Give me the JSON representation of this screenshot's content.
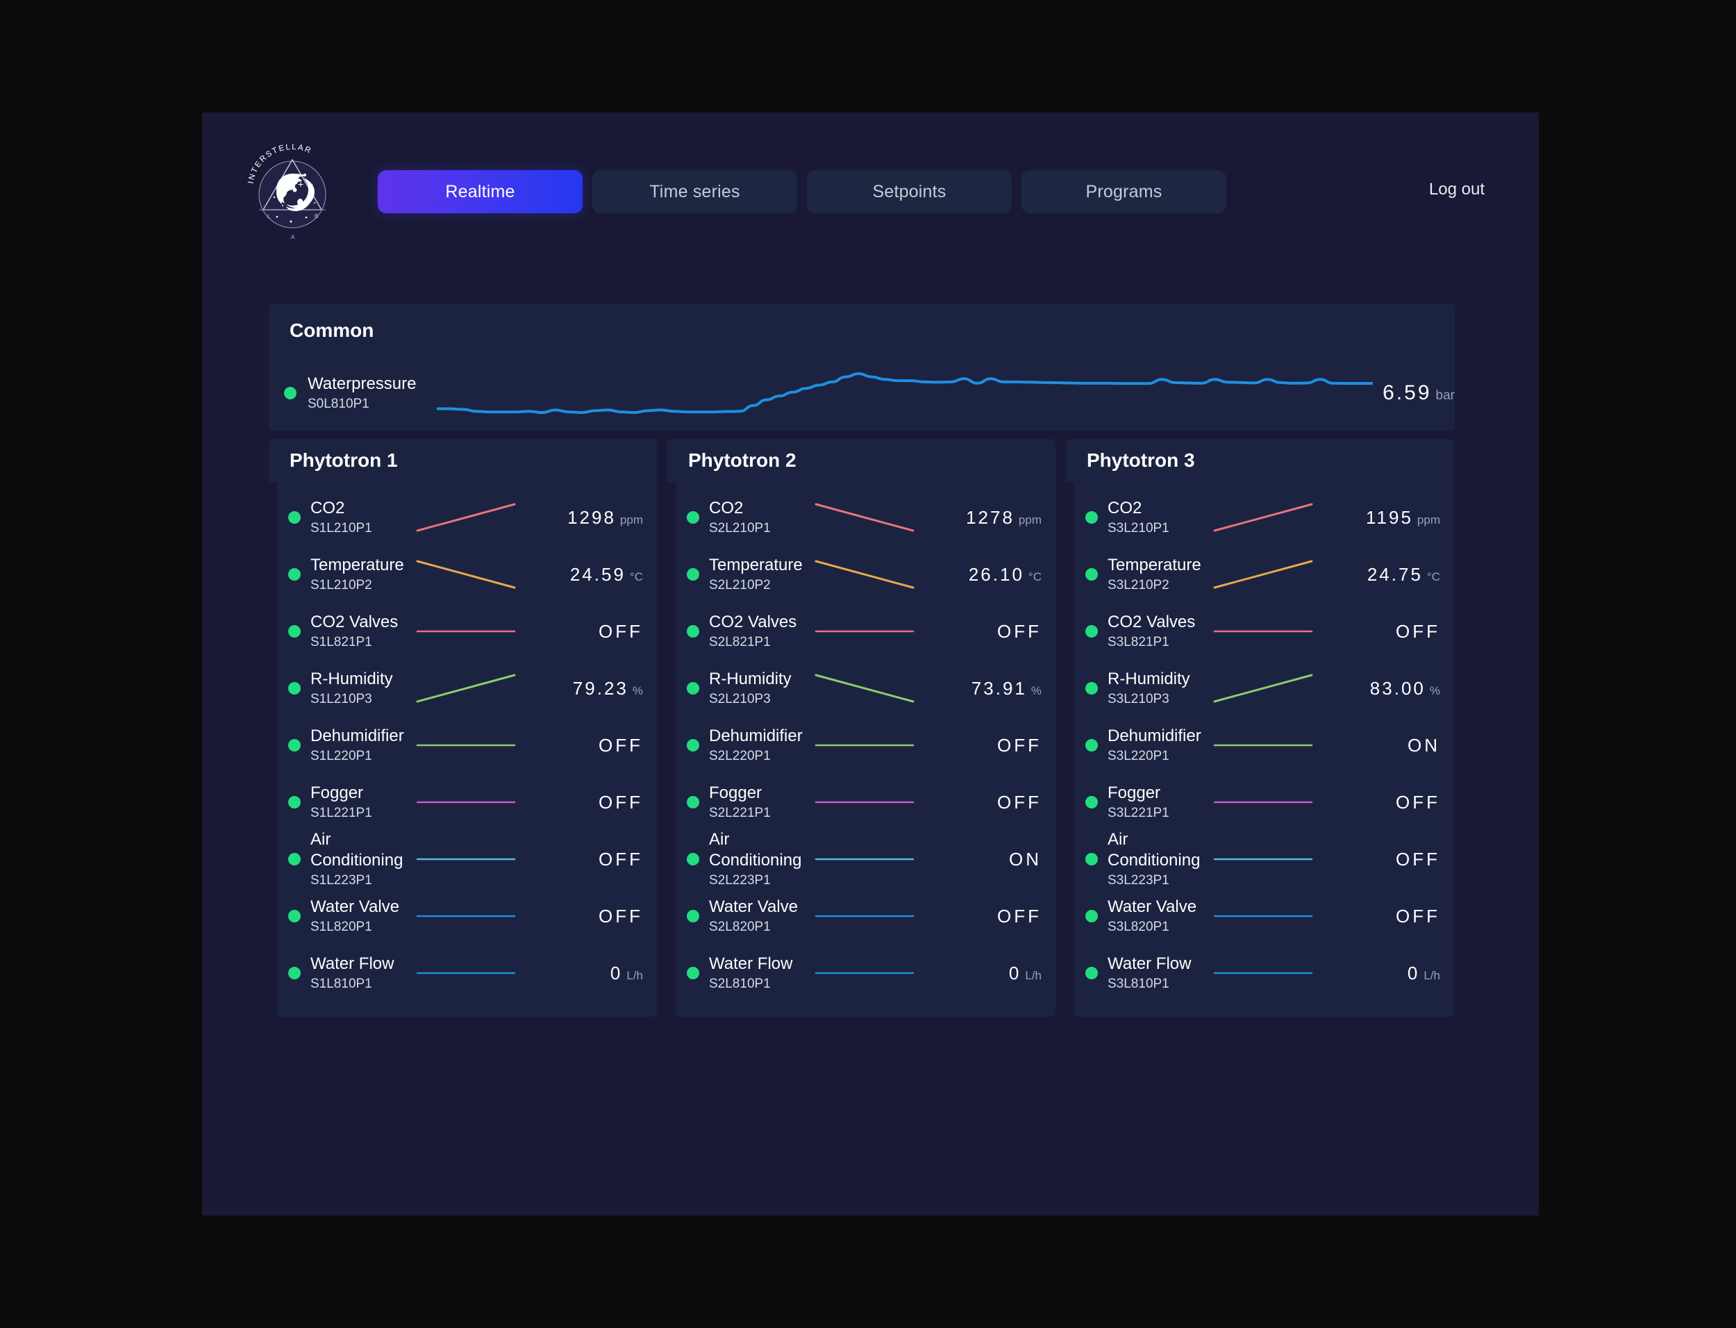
{
  "brand": {
    "name": "INTERSTELLAR",
    "ring_letters": [
      "I",
      "N",
      "T",
      "E",
      "R",
      "S",
      "T",
      "E",
      "L",
      "L",
      "A",
      "R"
    ],
    "bottom_letters": {
      "left": "L",
      "right": "B",
      "center": "A"
    }
  },
  "nav": {
    "tabs": [
      {
        "label": "Realtime",
        "active": true
      },
      {
        "label": "Time series",
        "active": false
      },
      {
        "label": "Setpoints",
        "active": false
      },
      {
        "label": "Programs",
        "active": false
      }
    ],
    "logout_label": "Log out"
  },
  "colors": {
    "accent_active": "#4a37ef",
    "status_ok": "#22dd7f",
    "co2": "#e8737f",
    "temperature": "#e8a84b",
    "humidity": "#8fcb6b",
    "fogger": "#c85bd0",
    "air": "#5fb6e0",
    "water": "#1f8fe0",
    "panel": "#1b2340",
    "frame": "#191935"
  },
  "common": {
    "title": "Common",
    "metric": {
      "name": "Waterpressure",
      "code": "S0L810P1",
      "value": "6.59",
      "unit": "bar",
      "status": "ok",
      "series_color": "#1f8fe0"
    }
  },
  "chart_data": {
    "type": "line",
    "title": "Waterpressure",
    "ylabel": "bar",
    "series": [
      {
        "name": "Waterpressure S0L810P1",
        "color": "#1f8fe0",
        "latest": 6.59,
        "unit": "bar",
        "values": [
          4.6,
          4.6,
          4.55,
          4.4,
          4.35,
          4.35,
          4.35,
          4.4,
          4.3,
          4.5,
          4.35,
          4.3,
          4.45,
          4.5,
          4.35,
          4.3,
          4.45,
          4.5,
          4.4,
          4.35,
          4.35,
          4.35,
          4.38,
          4.4,
          4.85,
          5.3,
          5.6,
          5.9,
          6.2,
          6.45,
          6.7,
          7.1,
          7.35,
          7.1,
          6.9,
          6.8,
          6.8,
          6.7,
          6.68,
          6.7,
          6.95,
          6.6,
          6.95,
          6.7,
          6.7,
          6.68,
          6.66,
          6.64,
          6.62,
          6.6,
          6.6,
          6.6,
          6.58,
          6.58,
          6.58,
          6.9,
          6.65,
          6.62,
          6.6,
          6.9,
          6.68,
          6.66,
          6.62,
          6.9,
          6.65,
          6.6,
          6.62,
          6.9,
          6.6,
          6.59,
          6.59,
          6.59
        ]
      }
    ]
  },
  "phytotrons": [
    {
      "title": "Phytotron 1",
      "metrics": [
        {
          "name": "CO2",
          "code": "S1L210P1",
          "value": "1298",
          "unit": "ppm",
          "status": "ok",
          "trend": "up",
          "color": "#e8737f",
          "kind": "numeric"
        },
        {
          "name": "Temperature",
          "code": "S1L210P2",
          "value": "24.59",
          "unit": "°C",
          "status": "ok",
          "trend": "down",
          "color": "#e8a84b",
          "kind": "numeric"
        },
        {
          "name": "CO2 Valves",
          "code": "S1L821P1",
          "value": "OFF",
          "unit": "",
          "status": "ok",
          "trend": "flat",
          "color": "#e8737f",
          "kind": "state"
        },
        {
          "name": "R-Humidity",
          "code": "S1L210P3",
          "value": "79.23",
          "unit": "%",
          "status": "ok",
          "trend": "up",
          "color": "#8fcb6b",
          "kind": "numeric"
        },
        {
          "name": "Dehumidifier",
          "code": "S1L220P1",
          "value": "OFF",
          "unit": "",
          "status": "ok",
          "trend": "flat",
          "color": "#8fcb6b",
          "kind": "state"
        },
        {
          "name": "Fogger",
          "code": "S1L221P1",
          "value": "OFF",
          "unit": "",
          "status": "ok",
          "trend": "flat",
          "color": "#c85bd0",
          "kind": "state"
        },
        {
          "name": "Air Conditioning",
          "code": "S1L223P1",
          "value": "OFF",
          "unit": "",
          "status": "ok",
          "trend": "flat",
          "color": "#5fb6e0",
          "kind": "state"
        },
        {
          "name": "Water Valve",
          "code": "S1L820P1",
          "value": "OFF",
          "unit": "",
          "status": "ok",
          "trend": "flat",
          "color": "#1f8fe0",
          "kind": "state"
        },
        {
          "name": "Water Flow",
          "code": "S1L810P1",
          "value": "0",
          "unit": "L/h",
          "status": "ok",
          "trend": "flat",
          "color": "#1f8fe0",
          "kind": "numeric"
        }
      ]
    },
    {
      "title": "Phytotron 2",
      "metrics": [
        {
          "name": "CO2",
          "code": "S2L210P1",
          "value": "1278",
          "unit": "ppm",
          "status": "ok",
          "trend": "down",
          "color": "#e8737f",
          "kind": "numeric"
        },
        {
          "name": "Temperature",
          "code": "S2L210P2",
          "value": "26.10",
          "unit": "°C",
          "status": "ok",
          "trend": "down",
          "color": "#e8a84b",
          "kind": "numeric"
        },
        {
          "name": "CO2 Valves",
          "code": "S2L821P1",
          "value": "OFF",
          "unit": "",
          "status": "ok",
          "trend": "flat",
          "color": "#e8737f",
          "kind": "state"
        },
        {
          "name": "R-Humidity",
          "code": "S2L210P3",
          "value": "73.91",
          "unit": "%",
          "status": "ok",
          "trend": "down",
          "color": "#8fcb6b",
          "kind": "numeric"
        },
        {
          "name": "Dehumidifier",
          "code": "S2L220P1",
          "value": "OFF",
          "unit": "",
          "status": "ok",
          "trend": "flat",
          "color": "#8fcb6b",
          "kind": "state"
        },
        {
          "name": "Fogger",
          "code": "S2L221P1",
          "value": "OFF",
          "unit": "",
          "status": "ok",
          "trend": "flat",
          "color": "#c85bd0",
          "kind": "state"
        },
        {
          "name": "Air Conditioning",
          "code": "S2L223P1",
          "value": "ON",
          "unit": "",
          "status": "ok",
          "trend": "flat",
          "color": "#5fb6e0",
          "kind": "state"
        },
        {
          "name": "Water Valve",
          "code": "S2L820P1",
          "value": "OFF",
          "unit": "",
          "status": "ok",
          "trend": "flat",
          "color": "#1f8fe0",
          "kind": "state"
        },
        {
          "name": "Water Flow",
          "code": "S2L810P1",
          "value": "0",
          "unit": "L/h",
          "status": "ok",
          "trend": "flat",
          "color": "#1f8fe0",
          "kind": "numeric"
        }
      ]
    },
    {
      "title": "Phytotron 3",
      "metrics": [
        {
          "name": "CO2",
          "code": "S3L210P1",
          "value": "1195",
          "unit": "ppm",
          "status": "ok",
          "trend": "up",
          "color": "#e8737f",
          "kind": "numeric"
        },
        {
          "name": "Temperature",
          "code": "S3L210P2",
          "value": "24.75",
          "unit": "°C",
          "status": "ok",
          "trend": "up",
          "color": "#e8a84b",
          "kind": "numeric"
        },
        {
          "name": "CO2 Valves",
          "code": "S3L821P1",
          "value": "OFF",
          "unit": "",
          "status": "ok",
          "trend": "flat",
          "color": "#e8737f",
          "kind": "state"
        },
        {
          "name": "R-Humidity",
          "code": "S3L210P3",
          "value": "83.00",
          "unit": "%",
          "status": "ok",
          "trend": "up",
          "color": "#8fcb6b",
          "kind": "numeric"
        },
        {
          "name": "Dehumidifier",
          "code": "S3L220P1",
          "value": "ON",
          "unit": "",
          "status": "ok",
          "trend": "flat",
          "color": "#8fcb6b",
          "kind": "state"
        },
        {
          "name": "Fogger",
          "code": "S3L221P1",
          "value": "OFF",
          "unit": "",
          "status": "ok",
          "trend": "flat",
          "color": "#c85bd0",
          "kind": "state"
        },
        {
          "name": "Air Conditioning",
          "code": "S3L223P1",
          "value": "OFF",
          "unit": "",
          "status": "ok",
          "trend": "flat",
          "color": "#5fb6e0",
          "kind": "state"
        },
        {
          "name": "Water Valve",
          "code": "S3L820P1",
          "value": "OFF",
          "unit": "",
          "status": "ok",
          "trend": "flat",
          "color": "#1f8fe0",
          "kind": "state"
        },
        {
          "name": "Water Flow",
          "code": "S3L810P1",
          "value": "0",
          "unit": "L/h",
          "status": "ok",
          "trend": "flat",
          "color": "#1f8fe0",
          "kind": "numeric"
        }
      ]
    }
  ]
}
